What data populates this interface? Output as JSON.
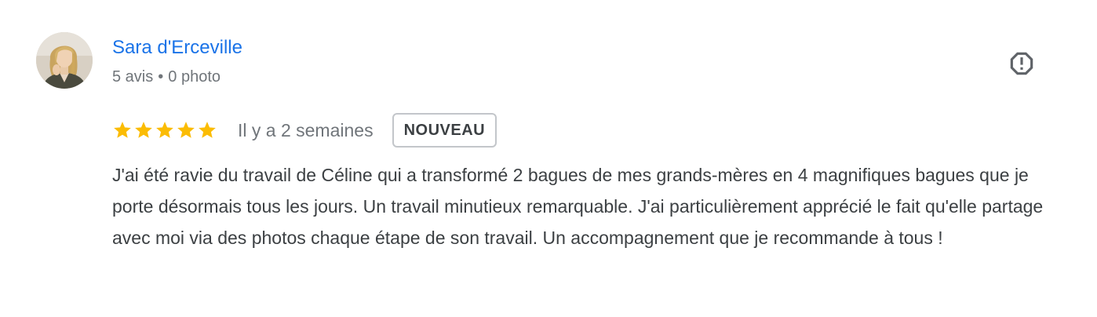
{
  "review": {
    "author": {
      "name": "Sara d'Erceville",
      "review_count": "5 avis",
      "separator": "•",
      "photo_count": "0 photo",
      "avatar": "profile-photo"
    },
    "rating": {
      "stars": 5,
      "max": 5,
      "star_icon": "star-icon",
      "star_color": "#fbbc04"
    },
    "date": "Il y a 2 semaines",
    "badge": "NOUVEAU",
    "report_icon": "report-octagon-icon",
    "text": "J'ai été ravie du travail de Céline qui a transformé 2 bagues de mes grands-mères en 4 magnifiques bagues que je porte désormais tous les jours. Un travail minutieux remarquable. J'ai particulièrement apprécié le fait qu'elle partage avec moi via des photos chaque étape de son travail. Un accompagnement que je recommande à tous !"
  },
  "colors": {
    "author_link": "#1a73e8",
    "secondary_text": "#70757a",
    "body_text": "#3c4043"
  }
}
